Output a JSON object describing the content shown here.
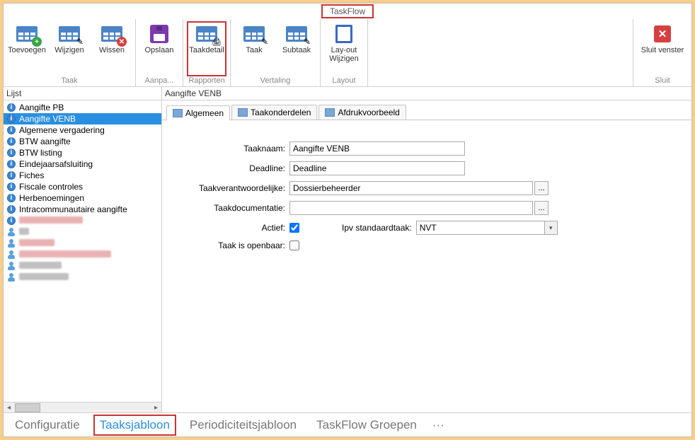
{
  "title": "TaskFlow",
  "ribbon": {
    "groups": [
      {
        "name": "Taak",
        "items": [
          {
            "label": "Toevoegen",
            "icon": "table-add"
          },
          {
            "label": "Wijzigen",
            "icon": "table-edit"
          },
          {
            "label": "Wissen",
            "icon": "table-delete"
          }
        ]
      },
      {
        "name": "Aanpa...",
        "items": [
          {
            "label": "Opslaan",
            "icon": "save"
          }
        ]
      },
      {
        "name": "Rapporten",
        "items": [
          {
            "label": "Taakdetail",
            "icon": "table-report",
            "highlight": true
          }
        ]
      },
      {
        "name": "Vertaling",
        "items": [
          {
            "label": "Taak",
            "icon": "table-edit2"
          },
          {
            "label": "Subtaak",
            "icon": "table-edit2"
          }
        ]
      },
      {
        "name": "Layout",
        "items": [
          {
            "label": "Lay-out Wijzigen",
            "icon": "book"
          }
        ]
      }
    ],
    "close": {
      "label": "Sluit venster",
      "group": "Sluit"
    }
  },
  "sidebar": {
    "header": "Lijst",
    "items": [
      {
        "label": "Aangifte PB",
        "icon": "globe",
        "redact": false
      },
      {
        "label": "Aangifte VENB",
        "icon": "globe",
        "redact": false,
        "selected": true
      },
      {
        "label": "Algemene vergadering",
        "icon": "globe",
        "redact": false
      },
      {
        "label": "BTW aangifte",
        "icon": "globe",
        "redact": false
      },
      {
        "label": "BTW listing",
        "icon": "globe",
        "redact": false
      },
      {
        "label": "Eindejaarsafsluiting",
        "icon": "globe",
        "redact": false
      },
      {
        "label": "Fiches",
        "icon": "globe",
        "redact": false
      },
      {
        "label": "Fiscale controles",
        "icon": "globe",
        "redact": false
      },
      {
        "label": "Herbenoemingen",
        "icon": "globe",
        "redact": false
      },
      {
        "label": "Intracommunautaire aangifte",
        "icon": "globe",
        "redact": false
      },
      {
        "label": "",
        "icon": "globe",
        "redact": true,
        "redactWidth": 90,
        "red": true
      },
      {
        "label": "",
        "icon": "person",
        "redact": true,
        "redactWidth": 14,
        "red": false,
        "gray": true
      },
      {
        "label": "",
        "icon": "person",
        "redact": true,
        "redactWidth": 50,
        "red": true
      },
      {
        "label": "",
        "icon": "person",
        "redact": true,
        "redactWidth": 130,
        "red": true
      },
      {
        "label": "",
        "icon": "person",
        "redact": true,
        "redactWidth": 60,
        "red": false,
        "gray": true
      },
      {
        "label": "",
        "icon": "person",
        "redact": true,
        "redactWidth": 70,
        "red": false,
        "gray": true
      }
    ]
  },
  "main": {
    "header": "Aangifte VENB",
    "tabs": [
      {
        "label": "Algemeen",
        "selected": true
      },
      {
        "label": "Taakonderdelen"
      },
      {
        "label": "Afdrukvoorbeeld"
      }
    ],
    "form": {
      "taaknaam": {
        "label": "Taaknaam:",
        "value": "Aangifte VENB"
      },
      "deadline": {
        "label": "Deadline:",
        "value": "Deadline"
      },
      "verantwoordelijke": {
        "label": "Taakverantwoordelijke:",
        "value": "Dossierbeheerder"
      },
      "documentatie": {
        "label": "Taakdocumentatie:",
        "value": ""
      },
      "actief": {
        "label": "Actief:",
        "checked": true
      },
      "standaard": {
        "label": "Ipv standaardtaak:",
        "value": "NVT"
      },
      "openbaar": {
        "label": "Taak is openbaar:",
        "checked": false
      }
    }
  },
  "bottomTabs": {
    "items": [
      {
        "label": "Configuratie"
      },
      {
        "label": "Taaksjabloon",
        "active": true
      },
      {
        "label": "Periodiciteitsjabloon"
      },
      {
        "label": "TaskFlow Groepen"
      }
    ],
    "more": "···"
  }
}
